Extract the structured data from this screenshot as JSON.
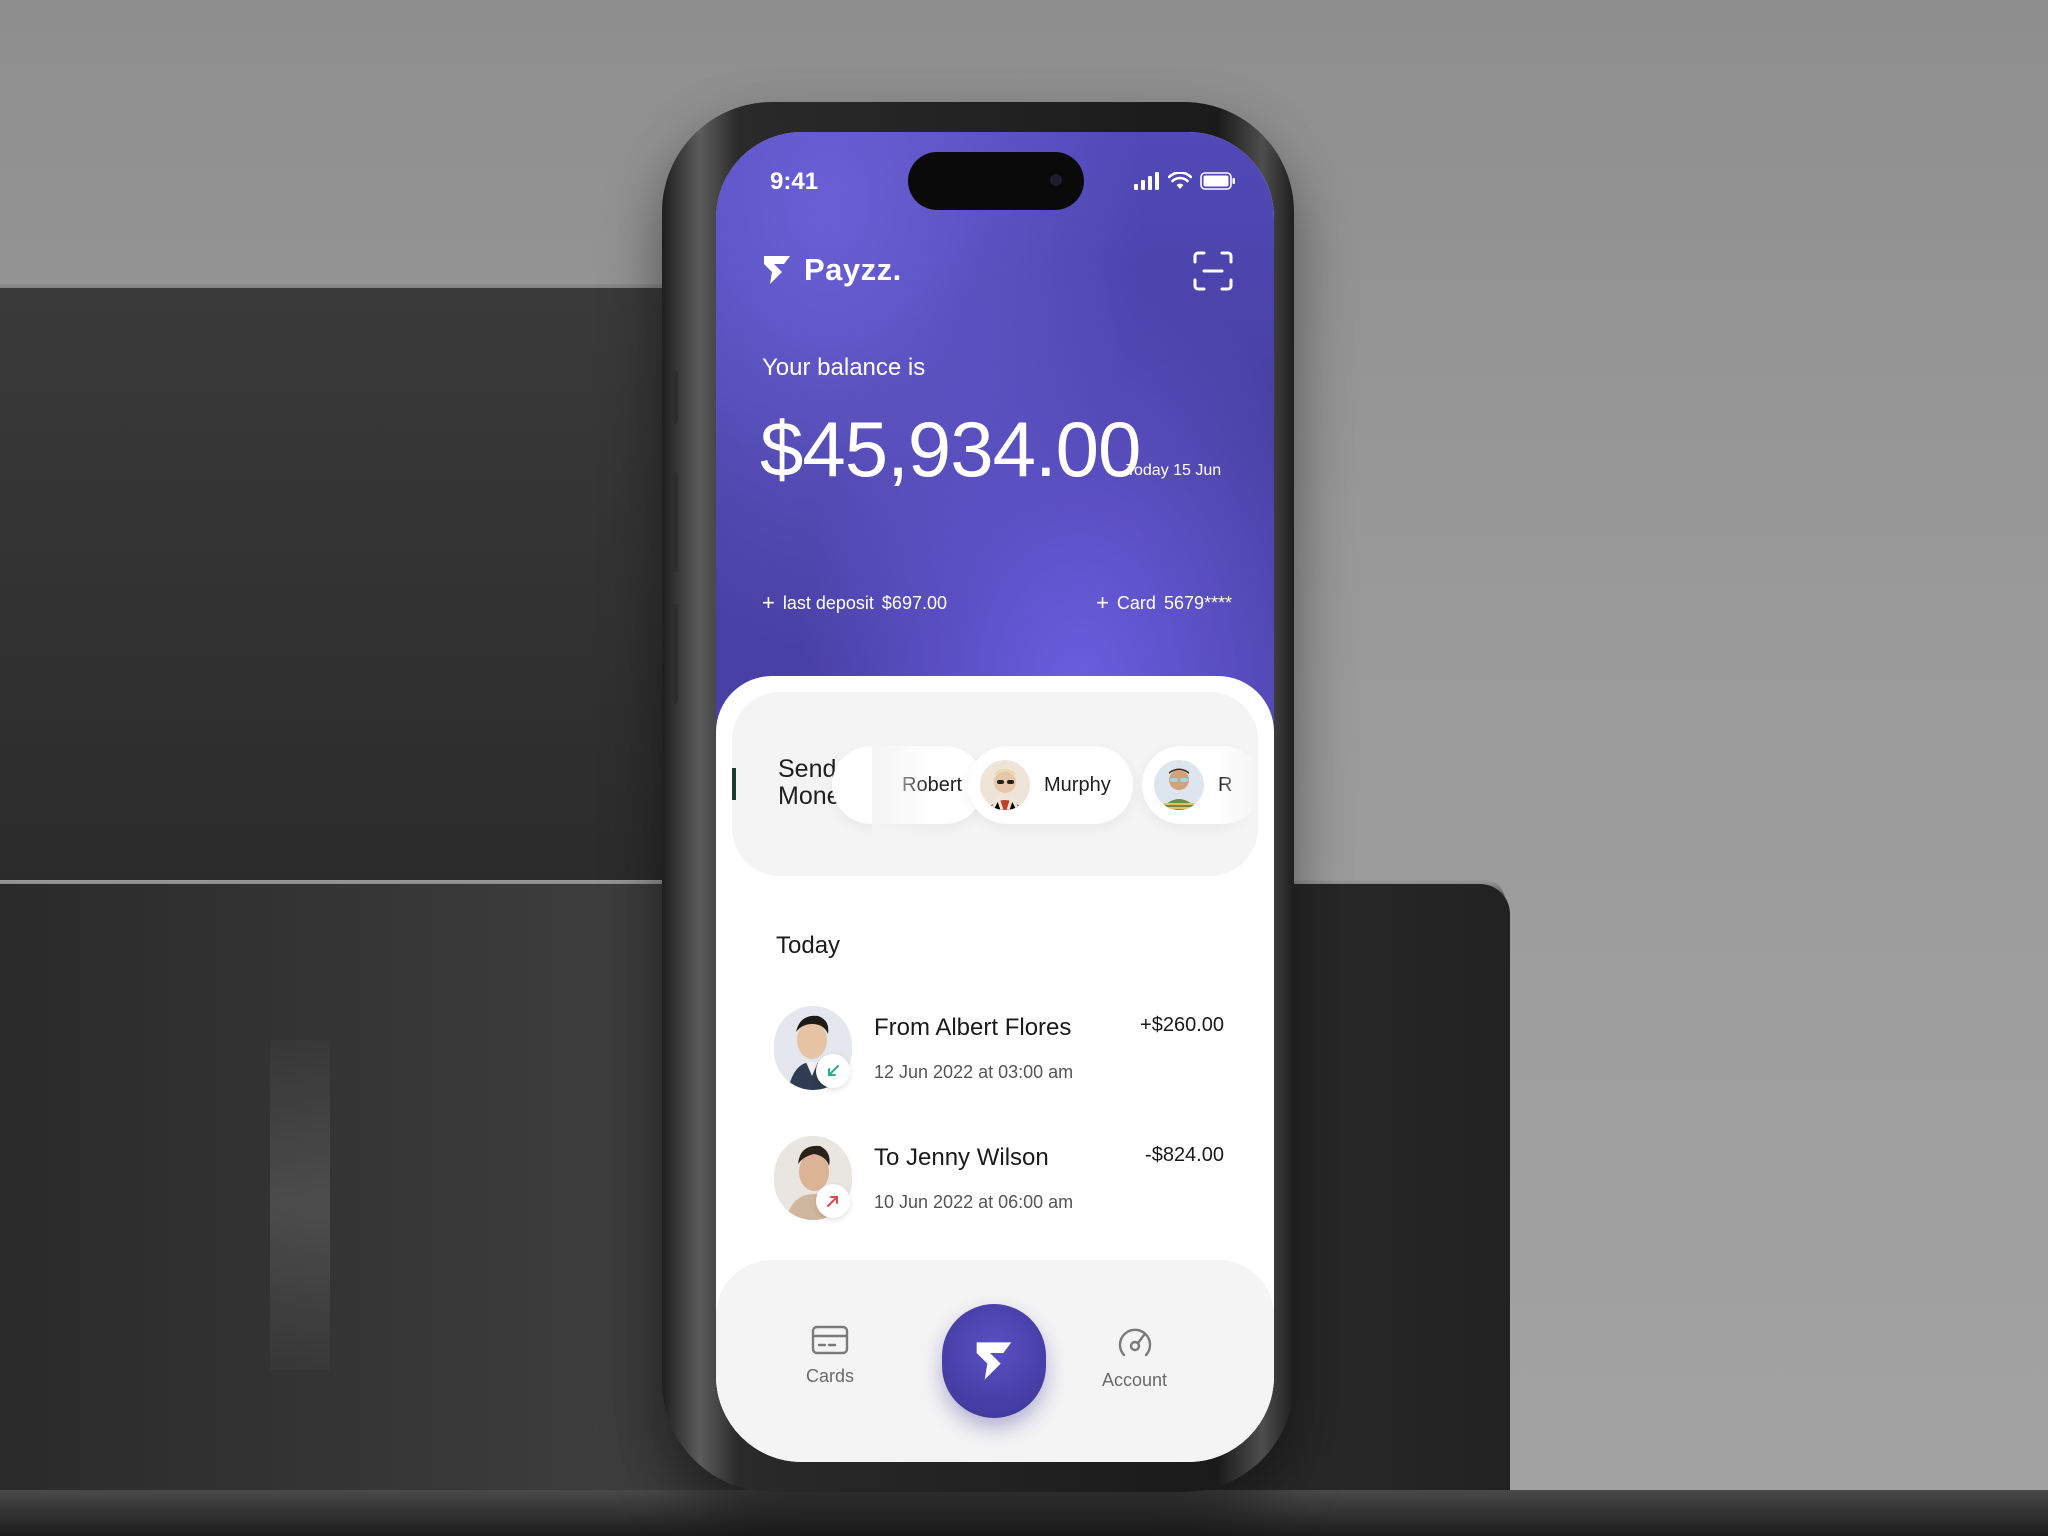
{
  "status_bar": {
    "time": "9:41",
    "icons": [
      "cellular-signal-icon",
      "wifi-icon",
      "battery-icon"
    ]
  },
  "header": {
    "brand_name": "Payzz.",
    "logo_icon": "payzz-logo-icon",
    "scan_icon": "scan-icon"
  },
  "balance": {
    "label": "Your balance is",
    "amount": "$45,934.00",
    "date": "Today 15 Jun",
    "last_deposit_label": "last deposit",
    "last_deposit_value": "$697.00",
    "card_label": "Card",
    "card_value": "5679****"
  },
  "send_money": {
    "title": "Send Money",
    "contacts": [
      {
        "name": "Robert"
      },
      {
        "name": "Murphy"
      },
      {
        "name": "R"
      }
    ]
  },
  "transactions": {
    "section_title": "Today",
    "items": [
      {
        "name": "From Albert Flores",
        "date": "12 Jun 2022 at 03:00 am",
        "amount": "+$260.00",
        "direction": "incoming",
        "badge_color": "#2aa98c"
      },
      {
        "name": "To Jenny Wilson",
        "date": "10 Jun 2022 at 06:00 am",
        "amount": "-$824.00",
        "direction": "outgoing",
        "badge_color": "#e0454a"
      }
    ]
  },
  "bottom_nav": {
    "items": [
      {
        "label": "Cards",
        "icon": "card-icon"
      },
      {
        "label": "Account",
        "icon": "gauge-icon"
      }
    ],
    "center_icon": "payzz-logo-icon"
  },
  "colors": {
    "accent": "#4a40aa",
    "accent_light": "#6b5ee0"
  }
}
